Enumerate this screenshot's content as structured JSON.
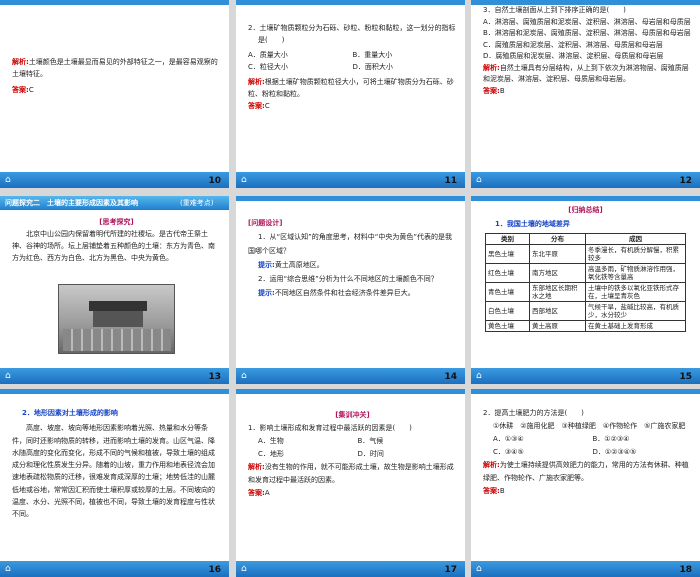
{
  "home_icon": "home-icon",
  "s10": {
    "page": "10",
    "text": "土壤颜色是土壤最显而易见的外部特征之一，是最容易观察的土壤特征。",
    "analysis_label": "解析:",
    "answer_label": "答案:",
    "answer": "C"
  },
  "s11": {
    "page": "11",
    "question": "2．土壤矿物质颗粒分为石砾、砂粒、粉粒和黏粒，这一划分的指标是(　　)",
    "options": [
      "A．质量大小",
      "B．重量大小",
      "C．粒径大小",
      "D．面积大小"
    ],
    "analysis_label": "解析:",
    "analysis": "根据土壤矿物质颗粒粒径大小，可将土壤矿物质分为石砾、砂粒、粉粒和黏粒。",
    "answer_label": "答案:",
    "answer": "C"
  },
  "s12": {
    "page": "12",
    "question": "3．自然土壤剖面从上到下排序正确的是(　　)",
    "options": [
      "A．淋溶层、腐殖质层和泥炭层、淀积层、淋溶层、母岩层和母质层",
      "B．淋溶层和泥炭层、腐殖质层、淀积层、淋溶层、母质层和母岩层",
      "C．腐殖质层和泥炭层、淀积层、淋溶层、母质层和母岩层",
      "D．腐殖质层和泥炭层、淋溶层、淀积层、母质层和母岩层"
    ],
    "analysis_label": "解析:",
    "analysis": "自然土壤具有分层结构，从上到下依次为淋溶物层、腐殖质层和泥炭层、淋溶层、淀积层、母质层和母岩层。",
    "answer_label": "答案:",
    "answer": "B"
  },
  "s13": {
    "page": "13",
    "header_left": "问题探究二　土壤的主要形成因素及其影响",
    "header_right": "(重难考点)",
    "tag": "[思考探究]",
    "text": "北京中山公园内保留着明代所建的社稷坛。是古代帝王祭土神、谷神的场所。坛上层铺垫着五种颜色的土壤：东方为青色、南方为红色、西方为白色、北方为黑色、中央为黄色。"
  },
  "s14": {
    "page": "14",
    "tag": "[问题设计]",
    "q1": "1．从“区域认知”的角度思考，材料中“中央为黄色”代表的是我国哪个区域？",
    "hint_label": "提示:",
    "hint1": "黄土高原地区。",
    "q2": "2．运用“综合思维”分析为什么不同地区的土壤颜色不同？",
    "hint2": "不同地区自然条件和社会经济条件差异巨大。"
  },
  "s15": {
    "page": "15",
    "tag": "[归纳总结]",
    "title": "1．我国土壤的地域差异",
    "headers": [
      "类别",
      "分布",
      "成因"
    ],
    "rows": [
      [
        "黑色土壤",
        "东北平原",
        "冬季漫长，有机质分解慢，积累较多"
      ],
      [
        "红色土壤",
        "南方地区",
        "高温多雨，矿物质淋溶作用强，氧化铁等含量高"
      ],
      [
        "青色土壤",
        "东部地区长期积水之地",
        "土壤中的铁多以氧化亚铁形式存在，土壤呈青灰色"
      ],
      [
        "白色土壤",
        "西部地区",
        "气候干旱，盐碱比较高，有机质少，水分较少"
      ],
      [
        "黄色土壤",
        "黄土高原",
        "在黄土基础上发育形成"
      ]
    ]
  },
  "s16": {
    "page": "16",
    "title": "2．地形因素对土壤形成的影响",
    "text": "高度、坡度、坡向等地形因素影响着光照、热量和水分等条件，同时还影响物质的转移，进而影响土壤的发育。山区气温、降水随高度的变化而变化，形成不同的气候和植被，导致土壤的组成成分和理化性质发生分异。随着的山坡，重力作用和地表径流会加速地表疏松物质的迁移，很难发育成深厚的土壤；地势低洼的山麓低地或谷地，常常因汇积而使土壤积厚或较厚的土层。不同坡向的温度、水分、光照不同，植被也不同，导致土壤的发育程度与性状不同。"
  },
  "s17": {
    "page": "17",
    "tag": "[集训冲关]",
    "question": "1．影响土壤形成和发育过程中最活跃的因素是(　　)",
    "options": [
      "A．生物",
      "B．气候",
      "C．地形",
      "D．时间"
    ],
    "analysis_label": "解析:",
    "analysis": "没有生物的作用，就不可能形成土壤，故生物是影响土壤形成和发育过程中最活跃的因素。",
    "answer_label": "答案:",
    "answer": "A"
  },
  "s18": {
    "page": "18",
    "question": "2．提高土壤肥力的方法是(　　)",
    "choices": "①休耕　②施用化肥　③种植绿肥　④作物轮作　⑤广施农家肥",
    "options": [
      "A．①③④",
      "B．①②③④",
      "C．③④⑤",
      "D．①②③④⑤"
    ],
    "analysis_label": "解析:",
    "analysis": "为使土壤持续提供高效肥力的能力，常用的方法有休耕、种植绿肥、作物轮作、广施农家肥等。",
    "answer_label": "答案:",
    "answer": "B"
  }
}
